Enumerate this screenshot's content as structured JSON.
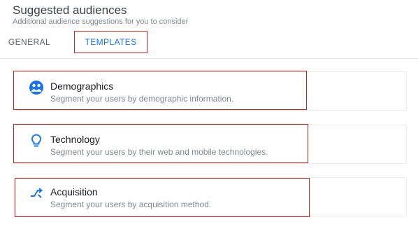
{
  "header": {
    "title": "Suggested audiences",
    "subtitle": "Additional audience suggestions for you to consider"
  },
  "tabs": [
    {
      "label": "GENERAL",
      "active": false
    },
    {
      "label": "TEMPLATES",
      "active": true
    }
  ],
  "templates": [
    {
      "icon": "demographics-icon",
      "title": "Demographics",
      "description": "Segment your users by demographic information."
    },
    {
      "icon": "lightbulb-icon",
      "title": "Technology",
      "description": "Segment your users by their web and mobile technologies."
    },
    {
      "icon": "acquisition-icon",
      "title": "Acquisition",
      "description": "Segment your users by acquisition method."
    }
  ],
  "colors": {
    "accent": "#1a73e8",
    "highlight_border": "#c5221f",
    "card_border": "#e8eaed",
    "secondary_text": "#80868b"
  }
}
